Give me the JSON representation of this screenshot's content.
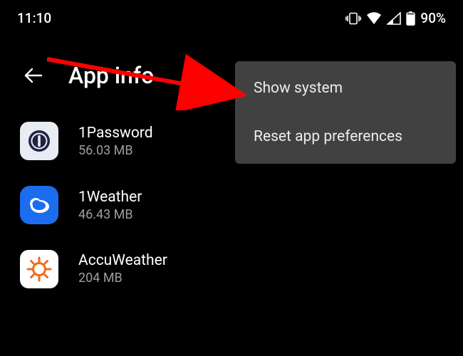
{
  "status": {
    "time": "11:10",
    "battery_percent": "90%"
  },
  "header": {
    "title": "App info"
  },
  "menu": {
    "show_system": "Show system",
    "reset_prefs": "Reset app preferences"
  },
  "apps": {
    "a0": {
      "name": "1Password",
      "size": "56.03 MB"
    },
    "a1": {
      "name": "1Weather",
      "size": "46.43 MB"
    },
    "a2": {
      "name": "AccuWeather",
      "size": "204 MB"
    }
  }
}
